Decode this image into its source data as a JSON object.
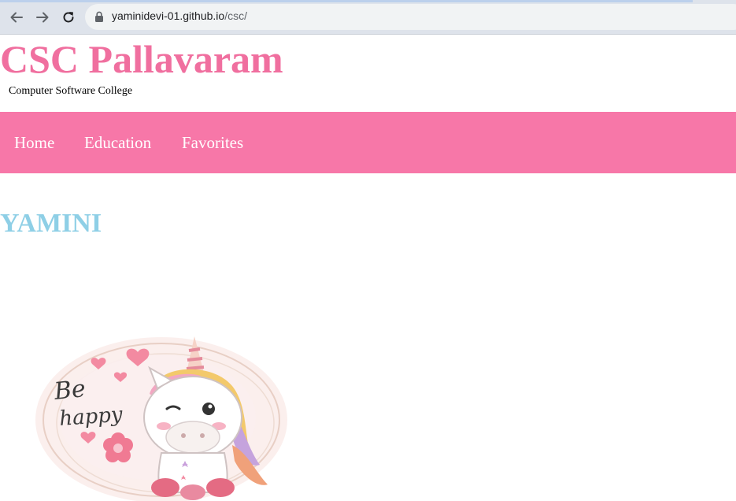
{
  "browser": {
    "back_icon": "arrow-left-icon",
    "forward_icon": "arrow-right-icon",
    "reload_icon": "reload-icon",
    "lock_icon": "lock-icon",
    "url_host": "yaminidevi-01.github.io",
    "url_path": "/csc/"
  },
  "header": {
    "title": "CSC Pallavaram",
    "subtitle": "Computer Software College",
    "title_color": "#f06f9f"
  },
  "nav": {
    "color": "#f777a8",
    "items": [
      {
        "label": "Home"
      },
      {
        "label": "Education"
      },
      {
        "label": "Favorites"
      }
    ]
  },
  "main": {
    "heading": "YAMINI",
    "heading_color": "#8ecfe6",
    "image": {
      "icon": "unicorn-illustration",
      "text": "Be happy"
    }
  }
}
